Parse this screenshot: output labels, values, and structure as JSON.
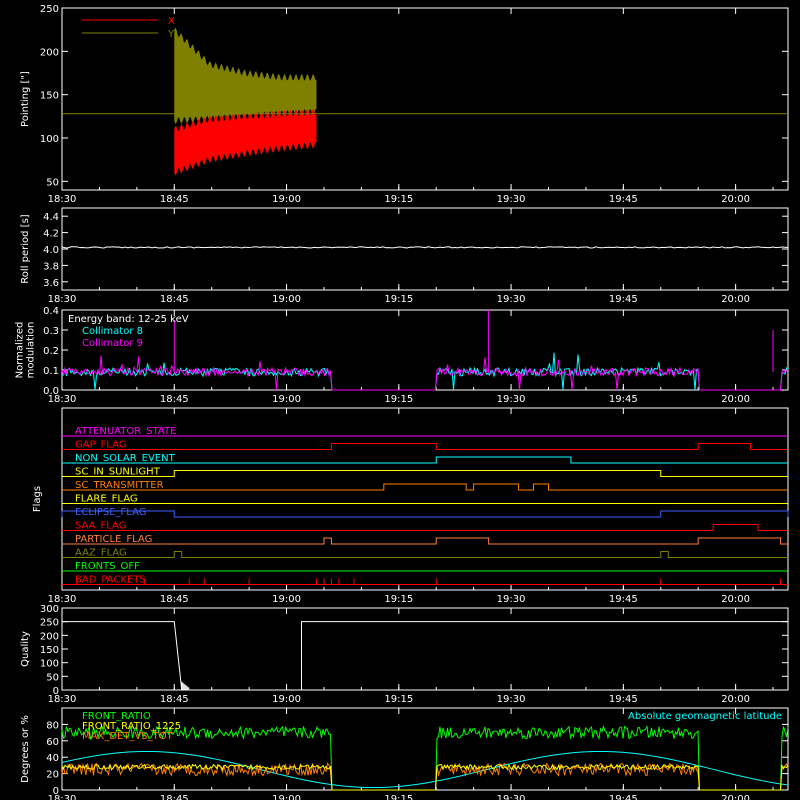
{
  "time_ticks": [
    "18:30",
    "18:45",
    "19:00",
    "19:15",
    "19:30",
    "19:45",
    "20:00"
  ],
  "chart_data": [
    {
      "type": "line",
      "ylabel": "Pointing [\"]",
      "ylim": [
        40,
        250
      ],
      "yticks": [
        "50",
        "100",
        "150",
        "200",
        "250"
      ],
      "series": [
        {
          "name": "X",
          "color": "#ff0000",
          "x": [
            "18:45",
            "18:50",
            "18:55",
            "19:00",
            "19:04"
          ],
          "y_upper": [
            110,
            122,
            125,
            128,
            130
          ],
          "y_lower": [
            60,
            75,
            82,
            88,
            92
          ]
        },
        {
          "name": "Y",
          "color": "#808000",
          "x": [
            "18:45",
            "18:50",
            "18:55",
            "19:00",
            "19:04"
          ],
          "y_upper": [
            225,
            185,
            175,
            170,
            170
          ],
          "y_lower": [
            120,
            122,
            125,
            128,
            130
          ]
        },
        {
          "name": "",
          "color": "#808000",
          "x": [
            "18:30",
            "20:07"
          ],
          "y": [
            128,
            128
          ]
        }
      ]
    },
    {
      "type": "line",
      "ylabel": "Roll period [s]",
      "ylim": [
        3.5,
        4.5
      ],
      "yticks": [
        "3.6",
        "3.8",
        "4.0",
        "4.2",
        "4.4"
      ],
      "series": [
        {
          "color": "#ffffff",
          "x": [
            "18:30",
            "20:07"
          ],
          "y": [
            4.02,
            4.02
          ]
        }
      ]
    },
    {
      "type": "line",
      "ylabel": "Normalized\nmodulation",
      "ylim": [
        0,
        0.4
      ],
      "yticks": [
        "0.0",
        "0.1",
        "0.2",
        "0.3",
        "0.4"
      ],
      "annotation": "Energy band: 12-25 keV",
      "series": [
        {
          "name": "Collimator 8",
          "color": "#00ffff"
        },
        {
          "name": "Collimator 9",
          "color": "#ff00ff"
        }
      ],
      "segments": [
        {
          "start": "18:30",
          "end": "19:06",
          "level": 0.09
        },
        {
          "start": "19:20",
          "end": "19:55",
          "level": 0.09
        },
        {
          "start": "20:06",
          "end": "20:07",
          "level": 0.1
        }
      ]
    },
    {
      "type": "table",
      "ylabel": "Flags",
      "flags": [
        {
          "name": "ATTENUATOR_STATE",
          "color": "#ff00ff",
          "highs": []
        },
        {
          "name": "GAP_FLAG",
          "color": "#ff0000",
          "highs": [
            [
              "19:06",
              "19:20"
            ],
            [
              "19:55",
              "20:02"
            ]
          ]
        },
        {
          "name": "NON_SOLAR_EVENT",
          "color": "#00ffff",
          "highs": [
            [
              "19:20",
              "19:38"
            ]
          ]
        },
        {
          "name": "SC_IN_SUNLIGHT",
          "color": "#ffff00",
          "highs": [
            [
              "18:45",
              "19:50"
            ]
          ]
        },
        {
          "name": "SC_TRANSMITTER",
          "color": "#ff8000",
          "highs": [
            [
              "19:13",
              "19:24"
            ],
            [
              "19:25",
              "19:31"
            ],
            [
              "19:33",
              "19:35"
            ]
          ]
        },
        {
          "name": "FLARE_FLAG",
          "color": "#ffff00",
          "highs": []
        },
        {
          "name": "ECLIPSE_FLAG",
          "color": "#4060ff",
          "highs": [
            [
              "18:30",
              "18:45"
            ],
            [
              "19:50",
              "20:07"
            ]
          ]
        },
        {
          "name": "SAA_FLAG",
          "color": "#ff0000",
          "highs": [
            [
              "19:57",
              "20:03"
            ]
          ]
        },
        {
          "name": "PARTICLE_FLAG",
          "color": "#ff8040",
          "highs": [
            [
              "19:05",
              "19:06"
            ],
            [
              "19:20",
              "19:27"
            ],
            [
              "19:55",
              "20:06"
            ]
          ]
        },
        {
          "name": "AAZ_FLAG",
          "color": "#808000",
          "highs": [
            [
              "18:45",
              "18:46"
            ],
            [
              "19:50",
              "19:51"
            ]
          ]
        },
        {
          "name": "FRONTS_OFF",
          "color": "#00ff00",
          "highs": []
        },
        {
          "name": "BAD_PACKETS",
          "color": "#ff0000",
          "highs": []
        }
      ]
    },
    {
      "type": "line",
      "ylabel": "Quality",
      "ylim": [
        0,
        300
      ],
      "yticks": [
        "0",
        "50",
        "100",
        "150",
        "200",
        "250",
        "300"
      ],
      "series": [
        {
          "color": "#ffffff",
          "x": [
            "18:30",
            "18:45",
            "18:46",
            "19:02",
            "19:02",
            "20:07"
          ],
          "y": [
            250,
            250,
            0,
            0,
            250,
            250
          ]
        }
      ]
    },
    {
      "type": "line",
      "ylabel": "Degrees or %",
      "ylim": [
        0,
        100
      ],
      "yticks": [
        "0",
        "20",
        "40",
        "60",
        "80"
      ],
      "series": [
        {
          "name": "FRONT_RATIO",
          "color": "#00ff00"
        },
        {
          "name": "FRONT_RATIO_1225",
          "color": "#ffff00"
        },
        {
          "name": "MAX_DET_VS_TOT",
          "color": "#ff8000"
        },
        {
          "name": "Absolute geomagnetic latitude",
          "color": "#00ffff"
        }
      ]
    }
  ]
}
